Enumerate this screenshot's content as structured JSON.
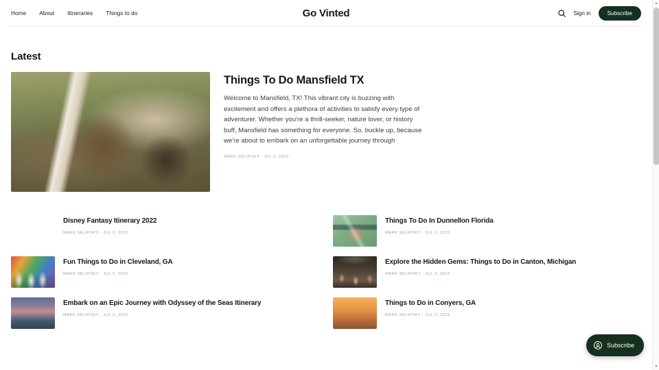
{
  "header": {
    "brand": "Go Vinted",
    "nav": [
      {
        "label": "Home",
        "name": "nav-home"
      },
      {
        "label": "About",
        "name": "nav-about"
      },
      {
        "label": "Itineraries",
        "name": "nav-itineraries"
      },
      {
        "label": "Things to do",
        "name": "nav-things-to-do"
      }
    ],
    "search_icon": "search-icon",
    "signin_label": "Sign in",
    "subscribe_label": "Subscribe",
    "accent_color": "#16301f"
  },
  "section": {
    "title": "Latest"
  },
  "featured": {
    "title": "Things To Do Mansfield TX",
    "excerpt": "Welcome to Mansfield, TX! This vibrant city is buzzing with excitement and offers a plethora of activities to satisfy every type of adventurer. Whether you're a thrill-seeker, nature lover, or history buff, Mansfield has something for everyone. So, buckle up, because we're about to embark on an unforgettable journey through",
    "author": "MARK SELIPSKY",
    "separator": "·",
    "date": "JUL 2, 2023",
    "image_name": "longhorn-cow-photo"
  },
  "cards": [
    {
      "title": "Disney Fantasy Itinerary 2022",
      "author": "MARK SELIPSKY",
      "separator": "·",
      "date": "JUL 2, 2023",
      "image_name": "disney-castle-night-photo",
      "image_class": "ph-disney"
    },
    {
      "title": "Things To Do In Dunnellon Florida",
      "author": "MARK SELIPSKY",
      "separator": "·",
      "date": "JUL 2, 2023",
      "image_name": "hand-holding-camera-photo",
      "image_class": "ph-camera"
    },
    {
      "title": "Fun Things to Do in Cleveland, GA",
      "author": "MARK SELIPSKY",
      "separator": "·",
      "date": "JUL 2, 2023",
      "image_name": "street-mural-crowd-photo",
      "image_class": "ph-mural"
    },
    {
      "title": "Explore the Hidden Gems: Things to Do in Canton, Michigan",
      "author": "MARK SELIPSKY",
      "separator": "·",
      "date": "JUL 2, 2023",
      "image_name": "concert-crowd-photo",
      "image_class": "ph-crowd"
    },
    {
      "title": "Embark on an Epic Journey with Odyssey of the Seas Itinerary",
      "author": "MARK SELIPSKY",
      "separator": "·",
      "date": "JUL 2, 2023",
      "image_name": "sunset-ocean-photo",
      "image_class": "ph-ocean"
    },
    {
      "title": "Things to Do in Conyers, GA",
      "author": "MARK SELIPSKY",
      "separator": "·",
      "date": "JUL 2, 2023",
      "image_name": "friends-sunset-photo",
      "image_class": "ph-sunset"
    }
  ],
  "portal": {
    "label": "Subscribe",
    "icon": "portal-circle-icon"
  },
  "scrollbar": {
    "up_arrow": "▲",
    "down_arrow": "▼"
  }
}
